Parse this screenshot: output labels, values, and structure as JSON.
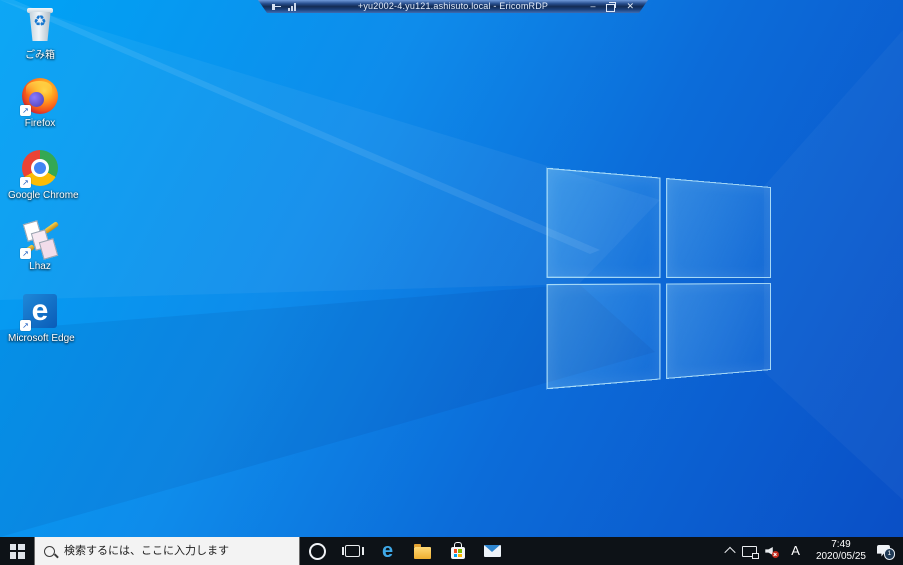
{
  "window": {
    "title": "+yu2002-4.yu121.ashisuto.local - EricomRDP"
  },
  "desktop_icons": [
    {
      "label": "ごみ箱"
    },
    {
      "label": "Firefox"
    },
    {
      "label": "Google Chrome"
    },
    {
      "label": "Lhaz"
    },
    {
      "label": "Microsoft Edge"
    }
  ],
  "taskbar": {
    "search_placeholder": "検索するには、ここに入力します",
    "ime": "A",
    "time": "7:49",
    "date": "2020/05/25",
    "notification_count": "1"
  },
  "icon_glyphs": {
    "recycle_symbol": "♻",
    "shortcut_arrow": "↗",
    "minimize": "–",
    "close": "✕",
    "edge_letter": "e"
  },
  "colors": {
    "wallpaper_top_left": "#00a3f5",
    "wallpaper_bottom_right": "#0a4fc6",
    "taskbar_background": "#0d1217",
    "rdp_bar_blue": "#1b3f78",
    "edge_blue": "#3fa9e8",
    "folder_yellow": "#f2b93c",
    "mute_badge_red": "#c42b1c"
  }
}
